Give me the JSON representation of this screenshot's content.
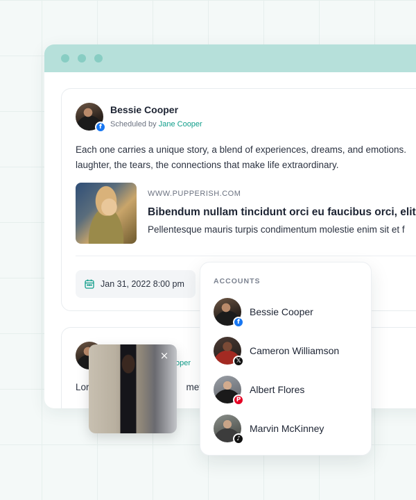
{
  "colors": {
    "accent": "#0f9d8a",
    "titlebar": "#b6e0da",
    "facebook": "#1877f2",
    "pinterest": "#e60023"
  },
  "post1": {
    "author": "Bessie Cooper",
    "scheduled_prefix": "Scheduled by ",
    "scheduled_by": "Jane Cooper",
    "network_icon": "facebook-icon",
    "text_line1": "Each one carries a unique story, a blend of experiences, dreams, and emotions.",
    "text_line2": "laughter, the tears, the connections that make life extraordinary.",
    "link": {
      "domain": "WWW.PUPPERISH.COM",
      "title": "Bibendum nullam tincidunt orci eu faucibus orci, elit",
      "description": "Pellentesque mauris turpis condimentum molestie enim sit et f"
    },
    "date": "Jan 31, 2022 8:00 pm"
  },
  "post2": {
    "meta_fragment": "Cooper",
    "text_start": "Lor",
    "text_end": "met c"
  },
  "accounts": {
    "heading": "ACCOUNTS",
    "items": [
      {
        "name": "Bessie Cooper",
        "network": "facebook-icon",
        "badge": "f"
      },
      {
        "name": "Cameron Williamson",
        "network": "x-icon",
        "badge": "𝕏"
      },
      {
        "name": "Albert Flores",
        "network": "pinterest-icon",
        "badge": "P"
      },
      {
        "name": "Marvin McKinney",
        "network": "tiktok-icon",
        "badge": "♪"
      }
    ]
  },
  "photo_popup": {
    "close_label": "×"
  }
}
